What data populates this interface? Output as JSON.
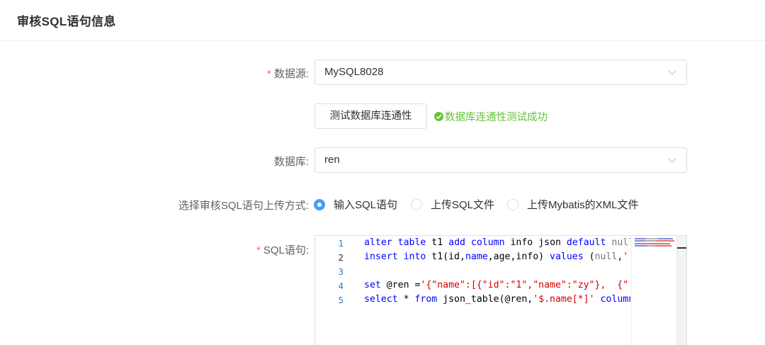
{
  "card": {
    "title": "审核SQL语句信息"
  },
  "form": {
    "datasource": {
      "label": "数据源:",
      "required_mark": "*",
      "value": "MySQL8028"
    },
    "test_button": "测试数据库连通性",
    "test_result": "数据库连通性测试成功",
    "database": {
      "label": "数据库:",
      "value": "ren"
    },
    "upload_mode": {
      "label": "选择审核SQL语句上传方式:",
      "options": [
        "输入SQL语句",
        "上传SQL文件",
        "上传Mybatis的XML文件"
      ],
      "selected": "输入SQL语句"
    },
    "sql": {
      "label": "SQL语句:",
      "required_mark": "*",
      "line_numbers": [
        "1",
        "2",
        "3",
        "4",
        "5"
      ],
      "active_line": "2"
    }
  },
  "colors": {
    "primary": "#409eff",
    "success": "#67c23a",
    "required": "#f56c6c",
    "keyword": "#0000ff",
    "string": "#d40000"
  },
  "icons": {
    "select_arrow": "chevron-down-icon",
    "success": "check-circle-icon"
  }
}
